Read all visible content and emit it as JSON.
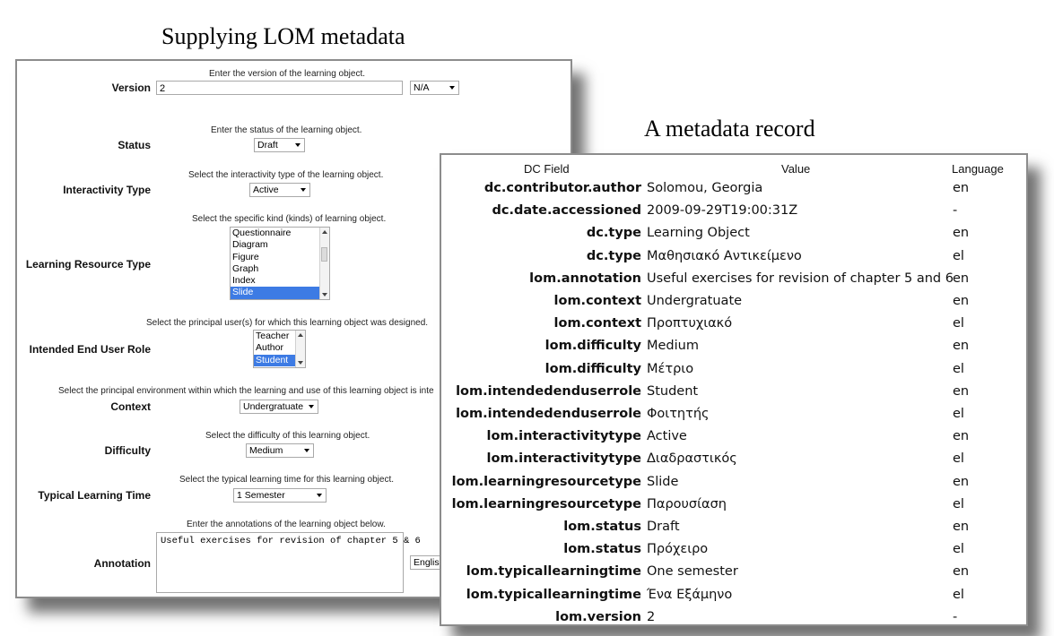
{
  "captions": {
    "left": "Supplying LOM metadata",
    "right": "A metadata record"
  },
  "form": {
    "version": {
      "hint": "Enter the version of the learning object.",
      "label": "Version",
      "value": "2",
      "lang": "N/A"
    },
    "status": {
      "hint": "Enter the status of the learning object.",
      "label": "Status",
      "value": "Draft"
    },
    "interactivity": {
      "hint": "Select the interactivity type of the learning object.",
      "label": "Interactivity Type",
      "value": "Active"
    },
    "resource_type": {
      "hint": "Select the specific kind (kinds) of learning object.",
      "label": "Learning Resource Type",
      "options": [
        "Questionnaire",
        "Diagram",
        "Figure",
        "Graph",
        "Index",
        "Slide"
      ],
      "selected": "Slide"
    },
    "end_user": {
      "hint": "Select the principal user(s) for which this learning object was designed.",
      "label": "Intended End User Role",
      "options": [
        "Teacher",
        "Author",
        "Student"
      ],
      "selected": "Student"
    },
    "context": {
      "hint": "Select the principal environment within which the learning and use of this learning object is inte",
      "label": "Context",
      "value": "Undergratuate"
    },
    "difficulty": {
      "hint": "Select the difficulty of this learning object.",
      "label": "Difficulty",
      "value": "Medium"
    },
    "learning_time": {
      "hint": "Select the typical learning time for this learning object.",
      "label": "Typical Learning Time",
      "value": "1 Semester"
    },
    "annotation": {
      "hint": "Enter the annotations of the learning object below.",
      "label": "Annotation",
      "value": "Useful exercises for revision of chapter 5 & 6",
      "lang": "Englis"
    }
  },
  "record": {
    "headers": {
      "field": "DC Field",
      "value": "Value",
      "language": "Language"
    },
    "rows": [
      {
        "field": "dc.contributor.author",
        "value": "Solomou, Georgia",
        "lang": "en"
      },
      {
        "field": "dc.date.accessioned",
        "value": "2009-09-29T19:00:31Z",
        "lang": "-"
      },
      {
        "field": "dc.type",
        "value": "Learning Object",
        "lang": "en"
      },
      {
        "field": "dc.type",
        "value": "Μαθησιακό Αντικείμενο",
        "lang": "el"
      },
      {
        "field": "lom.annotation",
        "value": "Useful exercises for revision of chapter 5 and 6",
        "lang": "en"
      },
      {
        "field": "lom.context",
        "value": "Undergratuate",
        "lang": "en"
      },
      {
        "field": "lom.context",
        "value": "Προπτυχιακό",
        "lang": "el"
      },
      {
        "field": "lom.difficulty",
        "value": "Medium",
        "lang": "en"
      },
      {
        "field": "lom.difficulty",
        "value": "Μέτριο",
        "lang": "el"
      },
      {
        "field": "lom.intendedenduserrole",
        "value": "Student",
        "lang": "en"
      },
      {
        "field": "lom.intendedenduserrole",
        "value": "Φοιτητής",
        "lang": "el"
      },
      {
        "field": "lom.interactivitytype",
        "value": "Active",
        "lang": "en"
      },
      {
        "field": "lom.interactivitytype",
        "value": "Διαδραστικός",
        "lang": "el"
      },
      {
        "field": "lom.learningresourcetype",
        "value": "Slide",
        "lang": "en"
      },
      {
        "field": "lom.learningresourcetype",
        "value": "Παρουσίαση",
        "lang": "el"
      },
      {
        "field": "lom.status",
        "value": "Draft",
        "lang": "en"
      },
      {
        "field": "lom.status",
        "value": "Πρόχειρο",
        "lang": "el"
      },
      {
        "field": "lom.typicallearningtime",
        "value": "One semester",
        "lang": "en"
      },
      {
        "field": "lom.typicallearningtime",
        "value": "Ένα Εξάμηνο",
        "lang": "el"
      },
      {
        "field": "lom.version",
        "value": "2",
        "lang": "-"
      }
    ]
  }
}
